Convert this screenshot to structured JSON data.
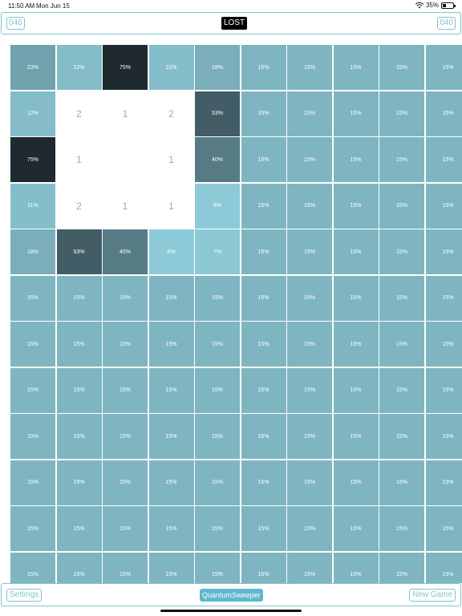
{
  "status_bar": {
    "time": "11:50 AM",
    "date": "Mon Jun 15",
    "battery": "35%"
  },
  "header": {
    "left_counter": "046",
    "status": "LOST",
    "right_counter": "040"
  },
  "board": {
    "rows": [
      [
        "23%",
        "12%",
        "75%",
        "11%",
        "18%",
        "15%",
        "15%",
        "15%",
        "15%",
        "15%"
      ],
      [
        "12%",
        "2",
        "1",
        "2",
        "53%",
        "15%",
        "15%",
        "15%",
        "15%",
        "15%"
      ],
      [
        "75%",
        "1",
        "",
        "1",
        "40%",
        "15%",
        "15%",
        "15%",
        "15%",
        "15%"
      ],
      [
        "11%",
        "2",
        "1",
        "1",
        "6%",
        "15%",
        "15%",
        "15%",
        "15%",
        "15%"
      ],
      [
        "18%",
        "53%",
        "40%",
        "6%",
        "7%",
        "15%",
        "15%",
        "15%",
        "15%",
        "15%"
      ],
      [
        "15%",
        "15%",
        "15%",
        "15%",
        "15%",
        "15%",
        "15%",
        "15%",
        "15%",
        "15%"
      ],
      [
        "15%",
        "15%",
        "15%",
        "15%",
        "15%",
        "15%",
        "15%",
        "15%",
        "15%",
        "15%"
      ],
      [
        "15%",
        "15%",
        "15%",
        "15%",
        "15%",
        "15%",
        "15%",
        "15%",
        "15%",
        "15%"
      ],
      [
        "15%",
        "15%",
        "15%",
        "15%",
        "15%",
        "15%",
        "15%",
        "15%",
        "15%",
        "15%"
      ],
      [
        "15%",
        "15%",
        "15%",
        "15%",
        "15%",
        "15%",
        "15%",
        "15%",
        "15%",
        "15%"
      ],
      [
        "15%",
        "15%",
        "15%",
        "15%",
        "15%",
        "15%",
        "15%",
        "15%",
        "15%",
        "15%"
      ],
      [
        "15%",
        "15%",
        "15%",
        "15%",
        "15%",
        "15%",
        "15%",
        "15%",
        "15%",
        "15%"
      ]
    ],
    "revealed_cells": [
      [
        1,
        1
      ],
      [
        1,
        2
      ],
      [
        1,
        3
      ],
      [
        2,
        1
      ],
      [
        2,
        2
      ],
      [
        2,
        3
      ],
      [
        3,
        1
      ],
      [
        3,
        2
      ],
      [
        3,
        3
      ]
    ],
    "colors": {
      "low": "#8fccd9",
      "high": "#1e2a30",
      "revealed": "#ffffff",
      "number": "#7ab8c8"
    }
  },
  "footer": {
    "settings_label": "Settings",
    "app_title": "QuantumSweeper",
    "new_game_label": "New Game"
  },
  "colors": {
    "accent": "#7fc4cf",
    "title_button": "#5fb8ce"
  }
}
